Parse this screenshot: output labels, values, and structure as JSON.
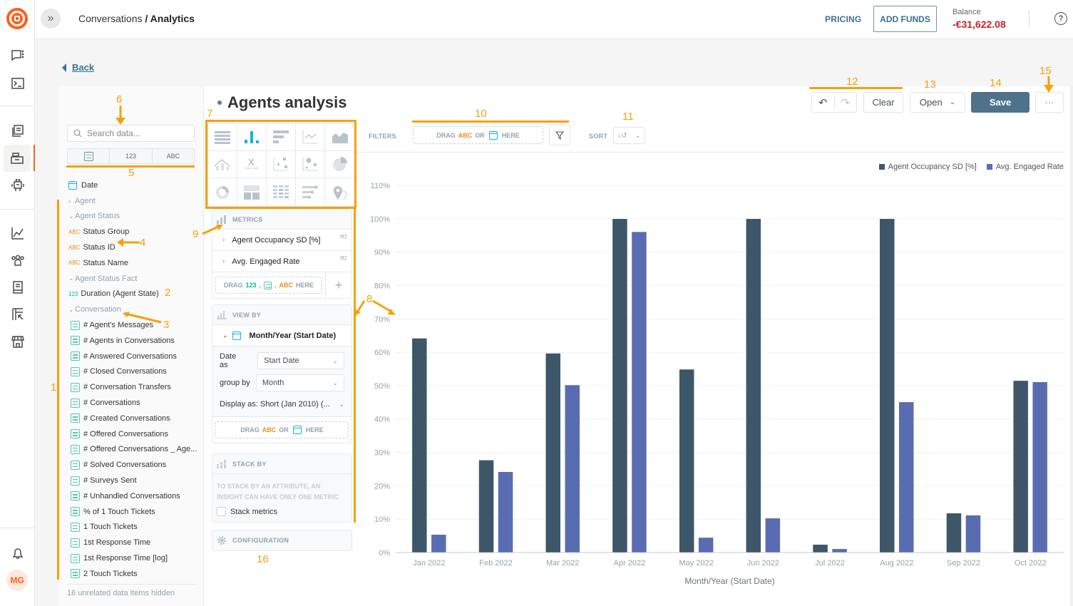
{
  "app": {
    "breadcrumb_parent": "Conversations",
    "breadcrumb_separator": " / ",
    "breadcrumb_current": "Analytics",
    "brand_color": "#fe5f1c"
  },
  "topbar": {
    "pricing_label": "PRICING",
    "add_funds_label": "ADD FUNDS",
    "balance_label": "Balance",
    "balance_value": "-€31,622.08",
    "help_icon": "?"
  },
  "rail": {
    "avatar_initials": "MG",
    "icons": [
      "conversations-icon",
      "console-icon",
      "knowledge-icon",
      "inbox-icon",
      "bot-icon",
      "analytics-icon",
      "contacts-icon",
      "docs-icon",
      "reports-icon",
      "store-icon",
      "bell-icon"
    ]
  },
  "nav": {
    "back_label": "Back"
  },
  "catalog": {
    "search_placeholder": "Search data...",
    "type_filters": [
      "fact",
      "123",
      "ABC"
    ],
    "items": [
      {
        "kind": "date",
        "label": "Date"
      },
      {
        "kind": "group-collapsed",
        "label": "Agent"
      },
      {
        "kind": "group",
        "label": "Agent Status"
      },
      {
        "kind": "attribute",
        "badge": "ABC",
        "label": "Status Group"
      },
      {
        "kind": "attribute",
        "badge": "ABC",
        "label": "Status ID"
      },
      {
        "kind": "attribute",
        "badge": "ABC",
        "label": "Status Name"
      },
      {
        "kind": "group",
        "label": "Agent Status Fact"
      },
      {
        "kind": "metric",
        "badge": "123",
        "label": "Duration (Agent State)"
      },
      {
        "kind": "group",
        "label": "Conversation"
      },
      {
        "kind": "fact",
        "label": "# Agent's Messages"
      },
      {
        "kind": "fact",
        "label": "# Agents in Conversations"
      },
      {
        "kind": "fact",
        "label": "# Answered Conversations"
      },
      {
        "kind": "fact",
        "label": "# Closed Conversations"
      },
      {
        "kind": "fact",
        "label": "# Conversation Transfers"
      },
      {
        "kind": "fact",
        "label": "# Conversations"
      },
      {
        "kind": "fact",
        "label": "# Created Conversations"
      },
      {
        "kind": "fact",
        "label": "# Offered Conversations"
      },
      {
        "kind": "fact",
        "label": "# Offered Conversations _ Age..."
      },
      {
        "kind": "fact",
        "label": "# Solved Conversations"
      },
      {
        "kind": "fact",
        "label": "# Surveys Sent"
      },
      {
        "kind": "fact",
        "label": "# Unhandled Conversations"
      },
      {
        "kind": "fact",
        "label": "% of 1 Touch Tickets"
      },
      {
        "kind": "fact",
        "label": "1 Touch Tickets"
      },
      {
        "kind": "fact",
        "label": "1st Response Time"
      },
      {
        "kind": "fact",
        "label": "1st Response Time [log]"
      },
      {
        "kind": "fact",
        "label": "2 Touch Tickets"
      }
    ],
    "hidden_note": "16 unrelated data items hidden"
  },
  "insight": {
    "title": "Agents analysis",
    "viz_types": [
      "table",
      "column",
      "bar",
      "line",
      "area",
      "combo",
      "headline",
      "scatter",
      "bubble",
      "pie",
      "donut",
      "treemap",
      "heatmap",
      "bullet",
      "geo"
    ],
    "selected_viz": "column"
  },
  "buckets": {
    "metrics_label": "METRICS",
    "metrics": [
      {
        "label": "Agent Occupancy SD [%]",
        "tag": "M1"
      },
      {
        "label": "Avg. Engaged Rate",
        "tag": "M2"
      }
    ],
    "metrics_drop": {
      "drag": "DRAG",
      "num": "123",
      "sep": ",",
      "abc": "ABC",
      "here": "HERE"
    },
    "add_label": "+",
    "view_by_label": "VIEW BY",
    "view_by_item": "Month/Year (Start Date)",
    "date_as_label": "Date as",
    "date_as_value": "Start Date",
    "group_by_label": "group by",
    "group_by_value": "Month",
    "display_as_label": "Display as: Short (Jan 2010) (...",
    "view_drop": {
      "drag": "DRAG",
      "abc": "ABC",
      "or": "OR",
      "here": "HERE"
    },
    "stack_by_label": "STACK BY",
    "stack_note": "TO STACK BY AN ATTRIBUTE, AN INSIGHT CAN HAVE ONLY ONE METRIC",
    "stack_metrics_label": "Stack metrics",
    "stack_metrics_checked": false,
    "configuration_label": "CONFIGURATION"
  },
  "toolbar": {
    "filters_label": "FILTERS",
    "filter_drop": {
      "drag": "DRAG",
      "abc": "ABC",
      "or": "OR",
      "here": "HERE"
    },
    "sort_label": "SORT",
    "clear_label": "Clear",
    "open_label": "Open",
    "save_label": "Save",
    "more_label": "···"
  },
  "annotations": [
    "1",
    "2",
    "3",
    "4",
    "5",
    "6",
    "7",
    "8",
    "9",
    "10",
    "11",
    "12",
    "13",
    "14",
    "15",
    "16"
  ],
  "chart_data": {
    "type": "bar",
    "title": "",
    "xlabel": "Month/Year (Start Date)",
    "ylabel": "",
    "categories": [
      "Jan 2022",
      "Feb 2022",
      "Mar 2022",
      "Apr 2022",
      "May 2022",
      "Jun 2022",
      "Jul 2022",
      "Aug 2022",
      "Sep 2022",
      "Oct 2022"
    ],
    "series": [
      {
        "name": "Agent Occupancy SD [%]",
        "color": "#3d5769",
        "values": [
          64.2,
          27.7,
          59.7,
          100,
          54.9,
          100,
          2.4,
          100,
          11.8,
          51.5
        ]
      },
      {
        "name": "Avg. Engaged Rate",
        "color": "#5a6cb1",
        "values": [
          5.4,
          24.2,
          50.2,
          96.1,
          4.5,
          10.3,
          1.1,
          45.1,
          11.2,
          51.1
        ]
      }
    ],
    "ylim": [
      0,
      110
    ],
    "yticks": [
      "0%",
      "10%",
      "20%",
      "30%",
      "40%",
      "50%",
      "60%",
      "70%",
      "80%",
      "90%",
      "100%",
      "110%"
    ],
    "grid": true,
    "legend": "top-right"
  }
}
